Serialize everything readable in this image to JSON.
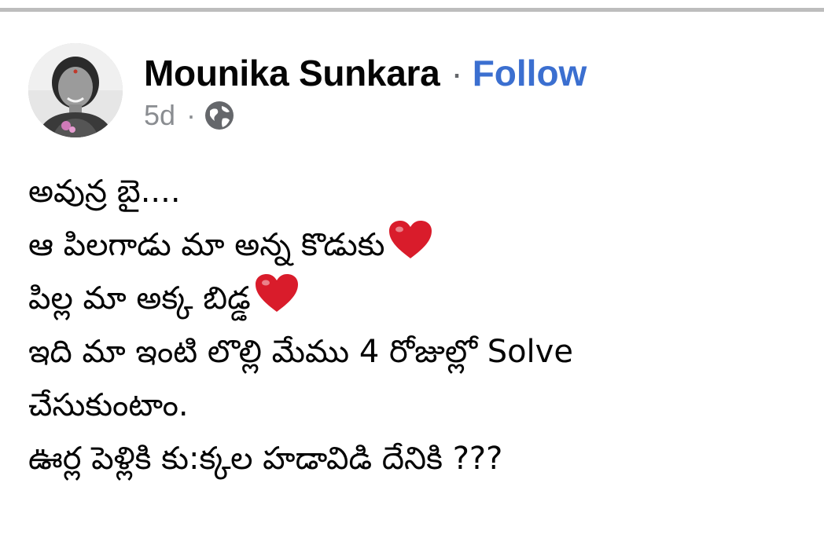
{
  "post": {
    "author": {
      "name": "Mounika Sunkara",
      "separator": "·",
      "follow_label": "Follow",
      "avatar_icon": "profile-photo"
    },
    "meta": {
      "time_ago": "5d",
      "separator": "·",
      "audience_icon": "globe-icon"
    },
    "body": {
      "lines": [
        {
          "text": "అవున్ర బై....",
          "emoji": ""
        },
        {
          "text": "ఆ పిలగాడు మా అన్న కొడుకు",
          "emoji": "❤️"
        },
        {
          "text": "పిల్ల మా అక్క బిడ్డ",
          "emoji": "❤️"
        },
        {
          "text": "ఇది మా ఇంటి లొల్లి మేము 4 రోజుల్లో Solve",
          "emoji": ""
        },
        {
          "text": "చేసుకుంటాం.",
          "emoji": ""
        },
        {
          "text": "ఊర్ల పెళ్లికి కు:క్కల హడావిడి దేనికి ???",
          "emoji": ""
        }
      ]
    }
  },
  "colors": {
    "follow": "#3b6fd0",
    "meta_text": "#8a8d91",
    "heart": "#d91c2b",
    "top_rule": "#bdbdbd"
  }
}
